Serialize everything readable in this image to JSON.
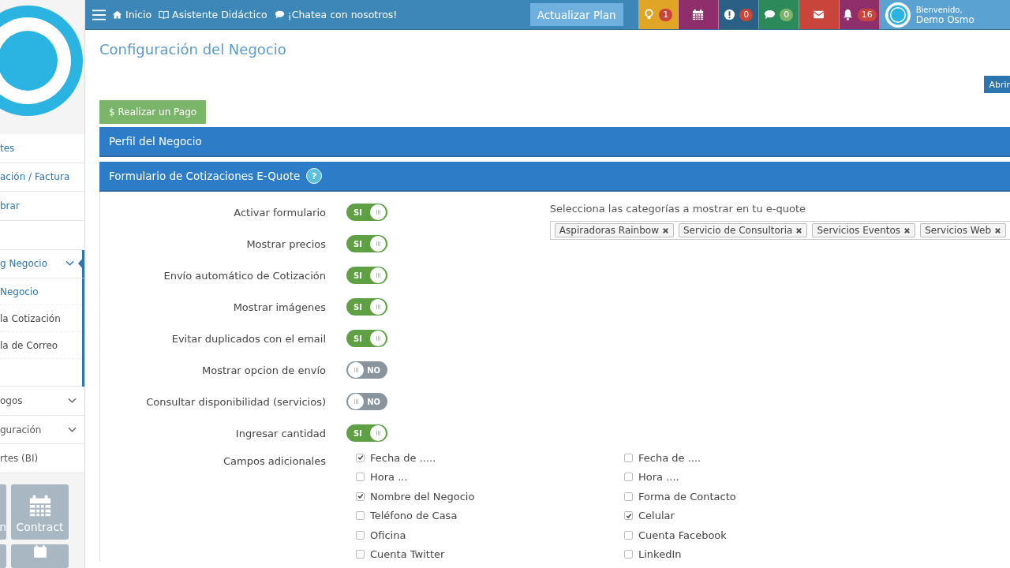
{
  "topbar": {
    "links": [
      {
        "kind": "home",
        "label": "Inicio"
      },
      {
        "kind": "book",
        "label": "Asistente Didáctico"
      },
      {
        "kind": "chat",
        "label": "¡Chatea con nosotros!"
      }
    ],
    "upgrade_button": "Actualizar Plan",
    "tiles": [
      {
        "kind": "bulb",
        "color": "#e0a526",
        "count": "1"
      },
      {
        "kind": "calendar",
        "color": "#8e2f6b"
      },
      {
        "kind": "alert",
        "color": "#2a5f86",
        "count": "0"
      },
      {
        "kind": "chat",
        "color": "#2c8a5a",
        "count": "0"
      },
      {
        "kind": "mail",
        "color": "#c9443a"
      },
      {
        "kind": "bell",
        "color": "#8e2f6b",
        "count": "16"
      }
    ],
    "user": {
      "greeting": "Bienvenido,",
      "name": "Demo Osmo"
    }
  },
  "sidebar": {
    "items": [
      {
        "label": "tes",
        "selected": false
      },
      {
        "label": "ación / Factura",
        "selected": false
      },
      {
        "label": "brar",
        "selected": false
      },
      {
        "selected": false
      },
      {
        "label": "g Negocio",
        "selected": true,
        "expanded": true,
        "children": [
          {
            "label": "Negocio",
            "selected": true
          },
          {
            "label": "la Cotización",
            "selected": false
          },
          {
            "label": "la de Correo",
            "selected": false
          }
        ]
      },
      {
        "label": "ogos",
        "selected": false,
        "expanded": false
      },
      {
        "label": "guración",
        "selected": false,
        "expanded": false
      },
      {
        "label": "rtes (BI)",
        "selected": false
      }
    ],
    "tiles": [
      {
        "label": "n"
      },
      {
        "label": "Contract"
      }
    ]
  },
  "page_title": "Configuración del Negocio",
  "open_button": "Abrir",
  "pay_button": "$ Realizar un Pago",
  "panels": [
    {
      "title": "Perfil del Negocio"
    },
    {
      "title": "Formulario de Cotizaciones E-Quote",
      "help": "?"
    }
  ],
  "toggles": [
    {
      "label": "Activar formulario",
      "on": true,
      "text": "SI"
    },
    {
      "label": "Mostrar precios",
      "on": true,
      "text": "SI"
    },
    {
      "label": "Envío automático de Cotización",
      "on": true,
      "text": "SI"
    },
    {
      "label": "Mostrar imágenes",
      "on": true,
      "text": "SI"
    },
    {
      "label": "Evitar duplicados con el email",
      "on": true,
      "text": "SI"
    },
    {
      "label": "Mostrar opcion de envío",
      "on": false,
      "text": "NO"
    },
    {
      "label": "Consultar disponibilidad (servicios)",
      "on": false,
      "text": "NO"
    },
    {
      "label": "Ingresar cantidad",
      "on": true,
      "text": "SI"
    }
  ],
  "categories": {
    "label": "Selecciona las categorías a mostrar en tu e-quote",
    "tags": [
      "Aspiradoras Rainbow",
      "Servicio de Consultoria",
      "Servicios Eventos",
      "Servicios Web"
    ]
  },
  "extra_fields": {
    "label": "Campos adicionales",
    "columns": [
      [
        {
          "label": "Fecha de .....",
          "checked": true
        },
        {
          "label": "Hora ...",
          "checked": false
        },
        {
          "label": "Nombre del Negocio",
          "checked": true
        },
        {
          "label": "Teléfono de Casa",
          "checked": false
        },
        {
          "label": "Oficina",
          "checked": false
        },
        {
          "label": "Cuenta Twitter",
          "checked": false
        }
      ],
      [
        {
          "label": "Fecha de ....",
          "checked": false
        },
        {
          "label": "Hora ....",
          "checked": false
        },
        {
          "label": "Forma de Contacto",
          "checked": false
        },
        {
          "label": "Celular",
          "checked": true
        },
        {
          "label": "Cuenta Facebook",
          "checked": false
        },
        {
          "label": "LinkedIn",
          "checked": false
        }
      ]
    ]
  }
}
